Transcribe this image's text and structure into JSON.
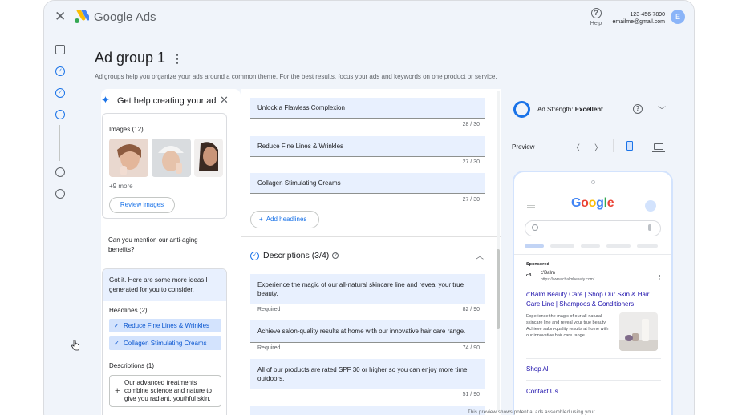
{
  "app": {
    "brand": "Google Ads",
    "help_label": "Help",
    "account_phone": "123-456-7890",
    "account_email": "emailme@gmail.com",
    "avatar_letter": "E"
  },
  "page": {
    "title": "Ad group 1",
    "subtitle": "Ad groups help you organize your ads around a common theme. For the best results, focus your ads and keywords on one product or service."
  },
  "assistant": {
    "title": "Get help creating your ad",
    "images_label": "Images (12)",
    "more_label": "+9 more",
    "review_button": "Review images",
    "user_question": "Can you mention our anti-aging benefits?",
    "reply": "Got it. Here are some more ideas I generated for you to consider.",
    "headlines_label": "Headlines (2)",
    "headline_suggestions": [
      "Reduce Fine Lines & Wrinkles",
      "Collagen Stimulating Creams"
    ],
    "descriptions_label": "Descriptions (1)",
    "description_suggestion": "Our advanced treatments combine science and nature to give you radiant, youthful skin."
  },
  "form": {
    "headlines": [
      {
        "text": "Unlock a Flawless Complexion",
        "count": "28 / 30"
      },
      {
        "text": "Reduce Fine Lines & Wrinkles",
        "count": "27 / 30"
      },
      {
        "text": "Collagen Stimulating Creams",
        "count": "27 / 30"
      }
    ],
    "add_headlines": "Add headlines",
    "descriptions_title": "Descriptions (3/4)",
    "descriptions": [
      {
        "text": "Experience the magic of our all-natural skincare line and reveal your true beauty.",
        "meta": "Required",
        "count": "82 / 90"
      },
      {
        "text": "Achieve salon-quality results at home with our innovative hair care range.",
        "meta": "Required",
        "count": "74 / 90"
      },
      {
        "text": "All of our products are rated SPF 30 or higher so you can enjoy more time outdoors.",
        "meta": "",
        "count": "51 / 90"
      }
    ]
  },
  "preview": {
    "strength_label": "Ad Strength:",
    "strength_value": "Excellent",
    "preview_label": "Preview",
    "google_logo": "Google",
    "sponsored": "Sponsored",
    "advertiser_icon": "cB",
    "advertiser": "c'Balm",
    "url": "https://www.cbalmbeauty.com/",
    "ad_title": "c'Balm Beauty Care | Shop Our Skin & Hair Care Line | Shampoos & Conditioners",
    "ad_body": "Experience the magic of our all-natural skincare line and reveal your true beauty. Achieve salon-quality results at home with our innovative hair care range.",
    "sitelinks": [
      "Shop All",
      "Contact Us"
    ],
    "disclaimer": "This preview shows potential ads assembled using your"
  },
  "colors": {
    "accent": "#1a73e8",
    "field_bg": "#e8f0fe",
    "chip_bg": "#d3e3fd"
  }
}
